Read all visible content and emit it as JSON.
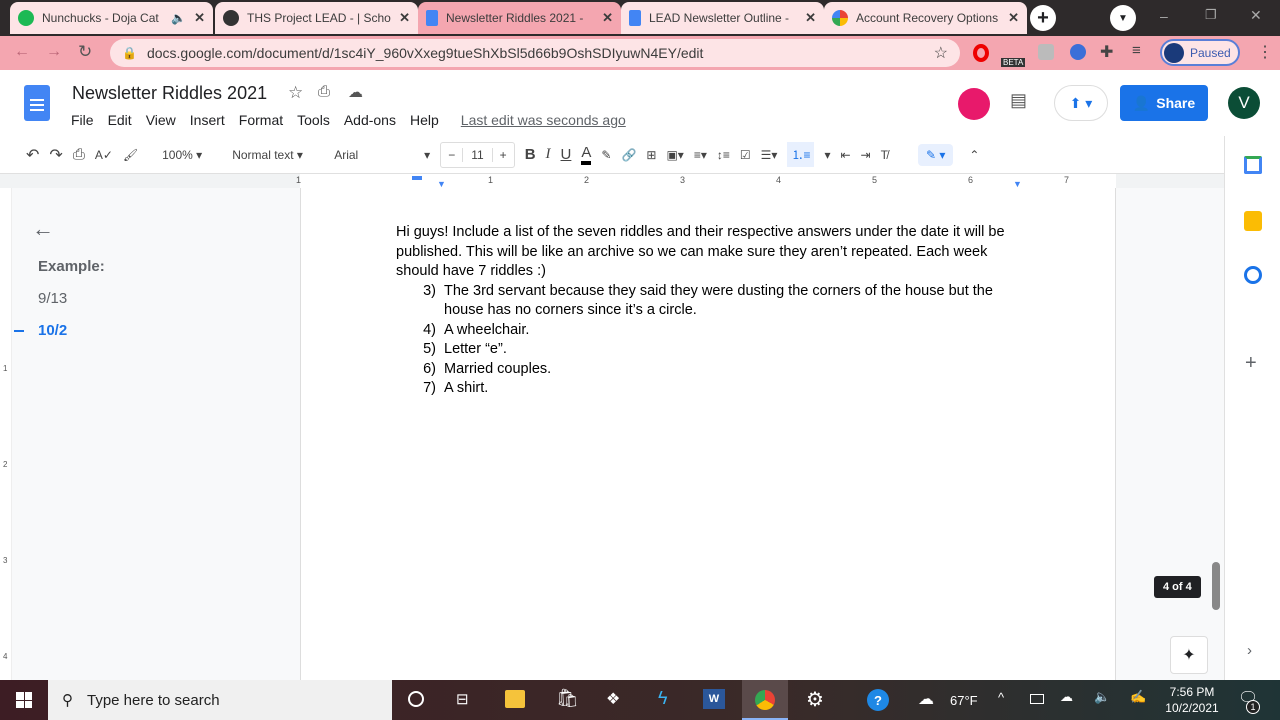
{
  "browser": {
    "tabs": [
      {
        "title": "Nunchucks - Doja Cat",
        "color": "#1db954"
      },
      {
        "title": "THS Project LEAD - | Schoo",
        "color": "#333"
      },
      {
        "title": "Newsletter Riddles 2021 -",
        "color": "#4285f4"
      },
      {
        "title": "LEAD Newsletter Outline -",
        "color": "#4285f4"
      },
      {
        "title": "Account Recovery Options",
        "color": "#ea4335"
      }
    ],
    "url": "docs.google.com/document/d/1sc4iY_960vXxeg9tueShXbSl5d66b9OshSDIyuwN4EY/edit",
    "profile_label": "Paused",
    "beta_badge": "BETA"
  },
  "doc": {
    "title": "Newsletter Riddles 2021",
    "menu": [
      "File",
      "Edit",
      "View",
      "Insert",
      "Format",
      "Tools",
      "Add-ons",
      "Help"
    ],
    "last_edit": "Last edit was seconds ago",
    "share_label": "Share",
    "avatar": "V"
  },
  "toolbar": {
    "zoom": "100%",
    "style": "Normal text",
    "font": "Arial",
    "font_size": "11"
  },
  "ruler": [
    "1",
    "1",
    "2",
    "3",
    "4",
    "5",
    "6",
    "7"
  ],
  "outline": {
    "heading": "Example:",
    "items": [
      "9/13",
      "10/2"
    ],
    "active": 1
  },
  "body": {
    "intro": "Hi guys! Include a list of the seven riddles and their respective answers under the date it will be published. This will be like an archive so we can make sure they aren’t repeated. Each week should have 7 riddles :)",
    "items": [
      {
        "n": "3)",
        "text": "The 3rd servant because they said they were dusting the corners of the house but the house has no corners since it’s a circle."
      },
      {
        "n": "4)",
        "text": "A wheelchair."
      },
      {
        "n": "5)",
        "text": "Letter “e”."
      },
      {
        "n": "6)",
        "text": "Married couples."
      },
      {
        "n": "7)",
        "text": "A shirt."
      }
    ]
  },
  "page_indicator": "4 of 4",
  "vruler": [
    "1",
    "2",
    "3",
    "4"
  ],
  "taskbar": {
    "search_placeholder": "Type here to search",
    "weather": "67°F",
    "time": "7:56 PM",
    "date": "10/2/2021",
    "notif_count": "1"
  }
}
